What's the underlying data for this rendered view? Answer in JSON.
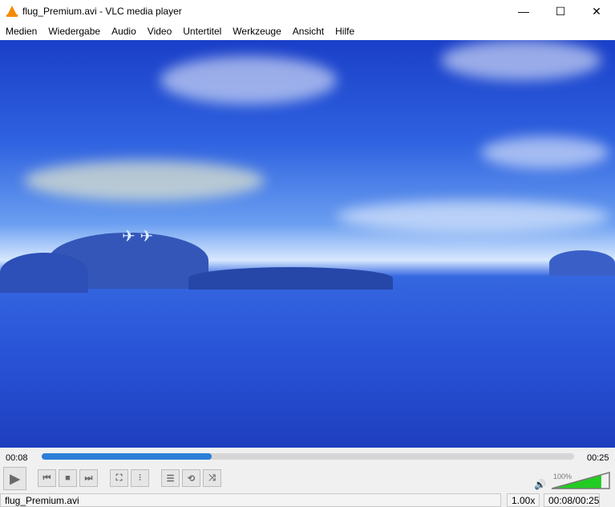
{
  "window": {
    "title": "flug_Premium.avi - VLC media player",
    "minimize": "—",
    "maximize": "☐",
    "close": "✕"
  },
  "menu": [
    "Medien",
    "Wiedergabe",
    "Audio",
    "Video",
    "Untertitel",
    "Werkzeuge",
    "Ansicht",
    "Hilfe"
  ],
  "playback": {
    "elapsed": "00:08",
    "total": "00:25",
    "progress_percent": 32
  },
  "controls": {
    "play": "▶",
    "prev": "⏮",
    "stop": "■",
    "next": "⏭",
    "fullscreen": "⛶",
    "extended": "⫶",
    "playlist": "☰",
    "loop": "⟲",
    "shuffle": "⤨"
  },
  "volume": {
    "label": "100%",
    "level_percent": 85,
    "icon": "🔊"
  },
  "status": {
    "filename": "flug_Premium.avi",
    "speed": "1.00x",
    "time": "00:08/00:25"
  },
  "colors": {
    "accent": "#2c7fd8",
    "volume": "#22cc22"
  }
}
